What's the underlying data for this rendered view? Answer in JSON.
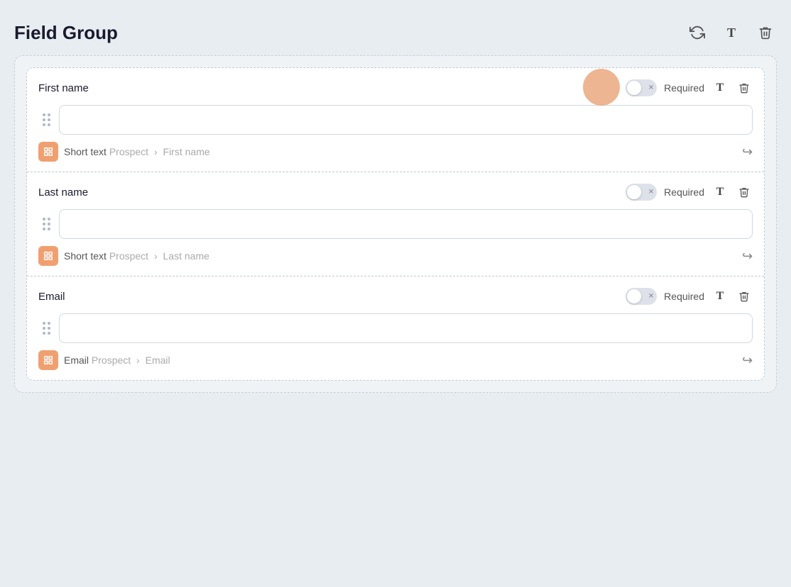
{
  "header": {
    "title": "Field Group",
    "actions": {
      "refresh_label": "↺",
      "type_label": "T",
      "delete_label": "🗑"
    }
  },
  "fields": [
    {
      "id": "first-name",
      "label": "First name",
      "required_text": "Required",
      "type_text": "Short text",
      "prospect_text": "Prospect",
      "arrow": "›",
      "field_name": "First name",
      "placeholder": ""
    },
    {
      "id": "last-name",
      "label": "Last name",
      "required_text": "Required",
      "type_text": "Short text",
      "prospect_text": "Prospect",
      "arrow": "›",
      "field_name": "Last name",
      "placeholder": ""
    },
    {
      "id": "email",
      "label": "Email",
      "required_text": "Required",
      "type_text": "Email",
      "prospect_text": "Prospect",
      "arrow": "›",
      "field_name": "Email",
      "placeholder": ""
    }
  ]
}
